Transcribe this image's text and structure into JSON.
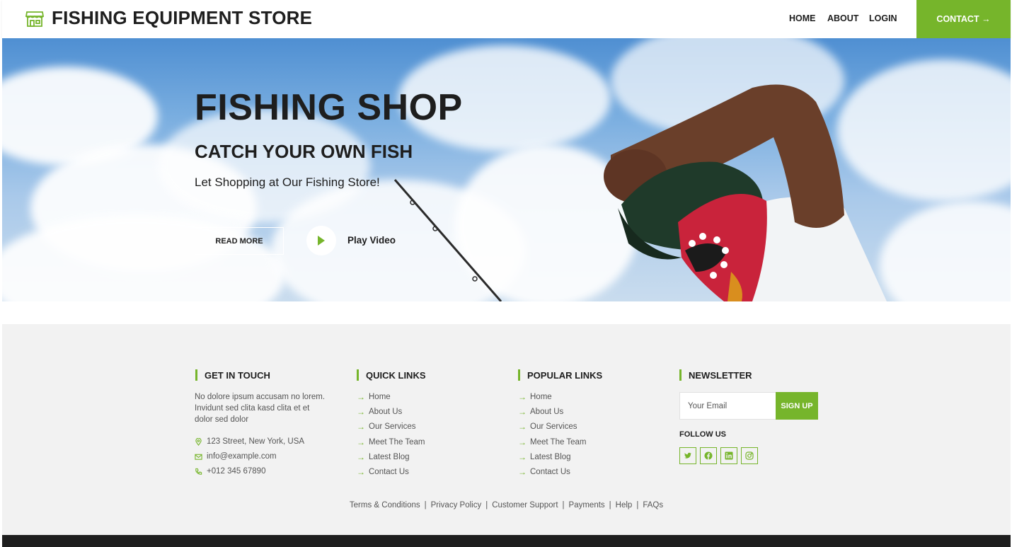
{
  "brand": {
    "name": "FISHING EQUIPMENT STORE",
    "icon": "storefront-icon"
  },
  "nav": {
    "items": [
      {
        "label": "HOME"
      },
      {
        "label": "ABOUT"
      },
      {
        "label": "LOGIN"
      }
    ],
    "contact_label": "CONTACT →"
  },
  "hero": {
    "title": "FISHING SHOP",
    "subtitle": "CATCH YOUR OWN FISH",
    "text": "Let Shopping at Our Fishing Store!",
    "read_more": "READ MORE",
    "play_label": "Play Video"
  },
  "footer": {
    "get_in_touch": {
      "heading": "GET IN TOUCH",
      "text_lines": [
        "No dolore ipsum accusam no lorem.",
        "Invidunt sed clita kasd clita et et",
        "dolor sed dolor"
      ],
      "address": "123 Street, New York, USA",
      "email": "info@example.com",
      "phone": "+012 345 67890"
    },
    "quick_links": {
      "heading": "QUICK LINKS",
      "items": [
        "Home",
        "About Us",
        "Our Services",
        "Meet The Team",
        "Latest Blog",
        "Contact Us"
      ]
    },
    "popular_links": {
      "heading": "POPULAR LINKS",
      "items": [
        "Home",
        "About Us",
        "Our Services",
        "Meet The Team",
        "Latest Blog",
        "Contact Us"
      ]
    },
    "newsletter": {
      "heading": "NEWSLETTER",
      "placeholder": "Your Email",
      "button": "SIGN UP",
      "follow_label": "FOLLOW US",
      "socials": [
        "twitter-icon",
        "facebook-icon",
        "linkedin-icon",
        "instagram-icon"
      ]
    },
    "legal_links": [
      "Terms & Conditions",
      "Privacy Policy",
      "Customer Support",
      "Payments",
      "Help",
      "FAQs"
    ]
  },
  "colors": {
    "accent": "#76b52b",
    "dark": "#1e1e1e",
    "footer_bg": "#f2f2f2"
  }
}
